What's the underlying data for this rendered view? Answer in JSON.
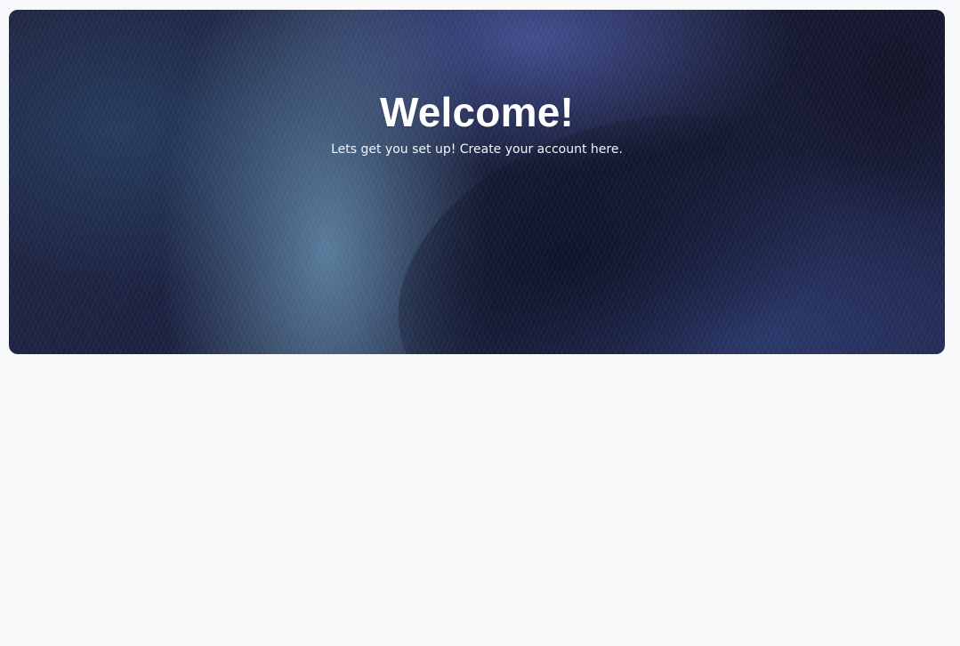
{
  "hero": {
    "title": "Welcome!",
    "subtitle": "Lets get you set up! Create your account here."
  },
  "colors": {
    "page_background": "#f7f8fa",
    "hero_base": "#1b2240",
    "hero_highlight": "#5c80a0",
    "text": "#ffffff"
  }
}
